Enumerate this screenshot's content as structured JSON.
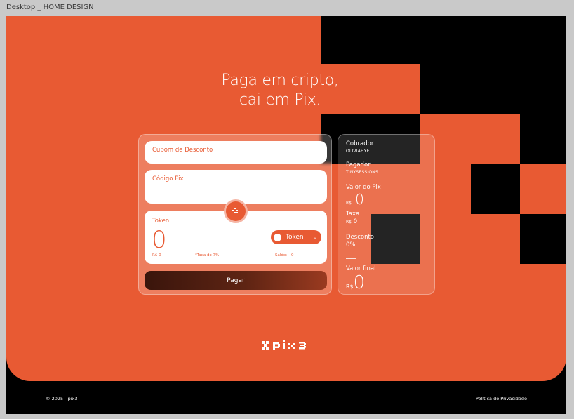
{
  "frame_label": "Desktop _ HOME DESIGN",
  "hero": {
    "headline_line1": "Paga em cripto,",
    "headline_line2": "cai em Pix."
  },
  "form": {
    "coupon_label": "Cupom de Desconto",
    "pix_code_label": "Código Pix",
    "token_label": "Token",
    "token_amount": "0",
    "token_select": "Token",
    "brl_value": "R$ 0",
    "fee_note": "*Taxa de 7%",
    "balance_label": "Saldo:",
    "balance_value": "0",
    "pay_button": "Pagar"
  },
  "summary": {
    "collector_label": "Cobrador",
    "collector_value": "OLIVIAHYE",
    "payer_label": "Pagador",
    "payer_value": "TINYSESSIONS",
    "pix_value_label": "Valor do Pix",
    "currency": "R$",
    "pix_value": "0",
    "fee_label": "Taxa",
    "fee_currency": "R$",
    "fee_value": "0",
    "discount_label": "Desconto",
    "discount_value": "0%",
    "final_label": "Valor final",
    "final_currency": "R$",
    "final_value": "0"
  },
  "footer": {
    "copyright": "© 2025 - pix3",
    "privacy": "Política de Privacidade"
  },
  "colors": {
    "brand_orange": "#e85a33",
    "black": "#000000"
  }
}
